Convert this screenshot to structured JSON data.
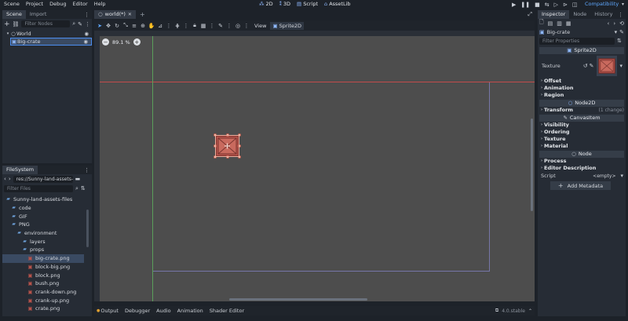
{
  "menu": [
    "Scene",
    "Project",
    "Debug",
    "Editor",
    "Help"
  ],
  "modes": [
    {
      "icon": "2d-icon",
      "glyph": "⁂",
      "label": "2D"
    },
    {
      "icon": "3d-icon",
      "glyph": "⁑",
      "label": "3D"
    },
    {
      "icon": "script-icon",
      "glyph": "▤",
      "label": "Script"
    },
    {
      "icon": "assetlib-icon",
      "glyph": "⌂",
      "label": "AssetLib"
    }
  ],
  "renderer": "Compatibility",
  "scene_dock": {
    "tabs": [
      "Scene",
      "Import"
    ],
    "filter_placeholder": "Filter Nodes",
    "nodes": [
      {
        "name": "World",
        "level": 0,
        "selected": false
      },
      {
        "name": "Big-crate",
        "level": 1,
        "selected": true
      }
    ]
  },
  "filesystem": {
    "tab": "FileSystem",
    "path": "res://Sunny-land-assets-file",
    "filter_placeholder": "Filter Files",
    "items": [
      {
        "name": "Sunny-land-assets-files",
        "level": 0,
        "type": "folder"
      },
      {
        "name": "code",
        "level": 1,
        "type": "folder"
      },
      {
        "name": "GIF",
        "level": 1,
        "type": "folder"
      },
      {
        "name": "PNG",
        "level": 1,
        "type": "folder"
      },
      {
        "name": "environment",
        "level": 2,
        "type": "folder"
      },
      {
        "name": "layers",
        "level": 3,
        "type": "folder"
      },
      {
        "name": "props",
        "level": 3,
        "type": "folder"
      },
      {
        "name": "big-crate.png",
        "level": 4,
        "type": "image",
        "selected": true
      },
      {
        "name": "block-big.png",
        "level": 4,
        "type": "image"
      },
      {
        "name": "block.png",
        "level": 4,
        "type": "image"
      },
      {
        "name": "bush.png",
        "level": 4,
        "type": "image"
      },
      {
        "name": "crank-down.png",
        "level": 4,
        "type": "image"
      },
      {
        "name": "crank-up.png",
        "level": 4,
        "type": "image"
      },
      {
        "name": "crate.png",
        "level": 4,
        "type": "image"
      }
    ]
  },
  "editor": {
    "tab": "world(*)",
    "add_tab": "+",
    "view_menu": "View",
    "context_node": "Sprite2D",
    "zoom": "89.1 %",
    "zoom_minus": "−",
    "zoom_plus": "+"
  },
  "bottom": {
    "tabs": [
      "Output",
      "Debugger",
      "Audio",
      "Animation",
      "Shader Editor"
    ],
    "version": "4.0.stable"
  },
  "inspector": {
    "tabs": [
      "Inspector",
      "Node",
      "History"
    ],
    "object": "Big-crate",
    "filter_placeholder": "Filter Properties",
    "class_sprite": "Sprite2D",
    "texture_label": "Texture",
    "sections_sprite": [
      "Offset",
      "Animation",
      "Region"
    ],
    "class_node2d": "Node2D",
    "transform_label": "Transform",
    "transform_note": "(1 change)",
    "class_canvas": "CanvasItem",
    "sections_canvas": [
      "Visibility",
      "Ordering",
      "Texture",
      "Material"
    ],
    "class_node": "Node",
    "sections_node": [
      "Process",
      "Editor Description"
    ],
    "script_label": "Script",
    "script_value": "<empty>",
    "add_metadata": "Add Metadata"
  },
  "colors": {
    "accent": "#4c8ef0",
    "selection": "#3a5a8a",
    "viewport_bg": "#4d4d4d",
    "crate": "#b5524a",
    "x_axis": "#c24a4a",
    "y_axis": "#5aa05a"
  }
}
